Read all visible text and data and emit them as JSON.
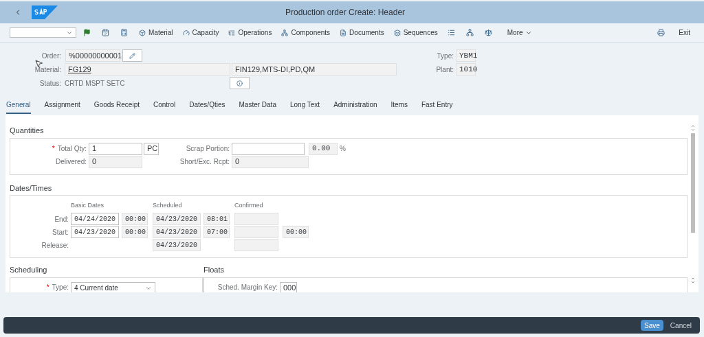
{
  "window": {
    "title": "Production order Create: Header"
  },
  "toolbar": {
    "buttons": [
      {
        "label": "Material"
      },
      {
        "label": "Capacity"
      },
      {
        "label": "Operations"
      },
      {
        "label": "Components"
      },
      {
        "label": "Documents"
      },
      {
        "label": "Sequences"
      }
    ],
    "more": "More",
    "exit": "Exit"
  },
  "header": {
    "order": {
      "label": "Order:",
      "value": "%00000000001"
    },
    "material": {
      "label": "Material:",
      "value": "FG129",
      "description": "FIN129,MTS-DI,PD,QM"
    },
    "status": {
      "label": "Status:",
      "value": "CRTD MSPT SETC"
    },
    "type": {
      "label": "Type:",
      "value": "YBM1"
    },
    "plant": {
      "label": "Plant:",
      "value": "1010"
    }
  },
  "tabs": [
    {
      "label": "General",
      "selected": true
    },
    {
      "label": "Assignment",
      "selected": false
    },
    {
      "label": "Goods Receipt",
      "selected": false
    },
    {
      "label": "Control",
      "selected": false
    },
    {
      "label": "Dates/Qties",
      "selected": false
    },
    {
      "label": "Master Data",
      "selected": false
    },
    {
      "label": "Long Text",
      "selected": false
    },
    {
      "label": "Administration",
      "selected": false
    },
    {
      "label": "Items",
      "selected": false
    },
    {
      "label": "Fast Entry",
      "selected": false
    }
  ],
  "quantities": {
    "title": "Quantities",
    "total_qty": {
      "label": "Total Qty:",
      "required_mark": "*",
      "value": "1",
      "editable": true,
      "unit": "PC"
    },
    "scrap_portion": {
      "label": "Scrap Portion:",
      "editable": true,
      "percent_value": "0.00",
      "percent_sign": "%"
    },
    "delivered": {
      "label": "Delivered:",
      "value": "0",
      "editable": false
    },
    "short_exc_rcpt": {
      "label": "Short/Exc. Rcpt:",
      "value": "0",
      "editable": false
    }
  },
  "dates": {
    "title": "Dates/Times",
    "columns": [
      "Basic Dates",
      "Scheduled",
      "Confirmed"
    ],
    "rows": [
      {
        "label": "End:",
        "basic": [
          {
            "value": "04/24/2020",
            "editable": true
          },
          {
            "value": "00:00",
            "editable": false
          }
        ],
        "scheduled": [
          {
            "value": "04/23/2020",
            "editable": false
          },
          {
            "value": "08:01",
            "editable": false
          }
        ],
        "confirmed": [
          {
            "editable": false
          }
        ]
      },
      {
        "label": "Start:",
        "basic": [
          {
            "value": "04/23/2020",
            "editable": true
          },
          {
            "value": "00:00",
            "editable": false
          }
        ],
        "scheduled": [
          {
            "value": "04/23/2020",
            "editable": false
          },
          {
            "value": "07:00",
            "editable": false
          }
        ],
        "confirmed": [
          {
            "editable": false
          },
          {
            "value": "00:00",
            "editable": false
          }
        ]
      },
      {
        "label": "Release:",
        "basic": [],
        "scheduled": [
          {
            "value": "04/23/2020",
            "editable": false
          }
        ],
        "confirmed": [
          {
            "editable": false
          }
        ]
      }
    ]
  },
  "scheduling": {
    "title": "Scheduling",
    "type": {
      "label": "Type:",
      "required_mark": "*",
      "value": "4 Current date"
    }
  },
  "floats": {
    "title": "Floats",
    "margin_key": {
      "label": "Sched. Margin Key:",
      "value": "000"
    }
  },
  "footer": {
    "save": "Save",
    "cancel": "Cancel"
  }
}
